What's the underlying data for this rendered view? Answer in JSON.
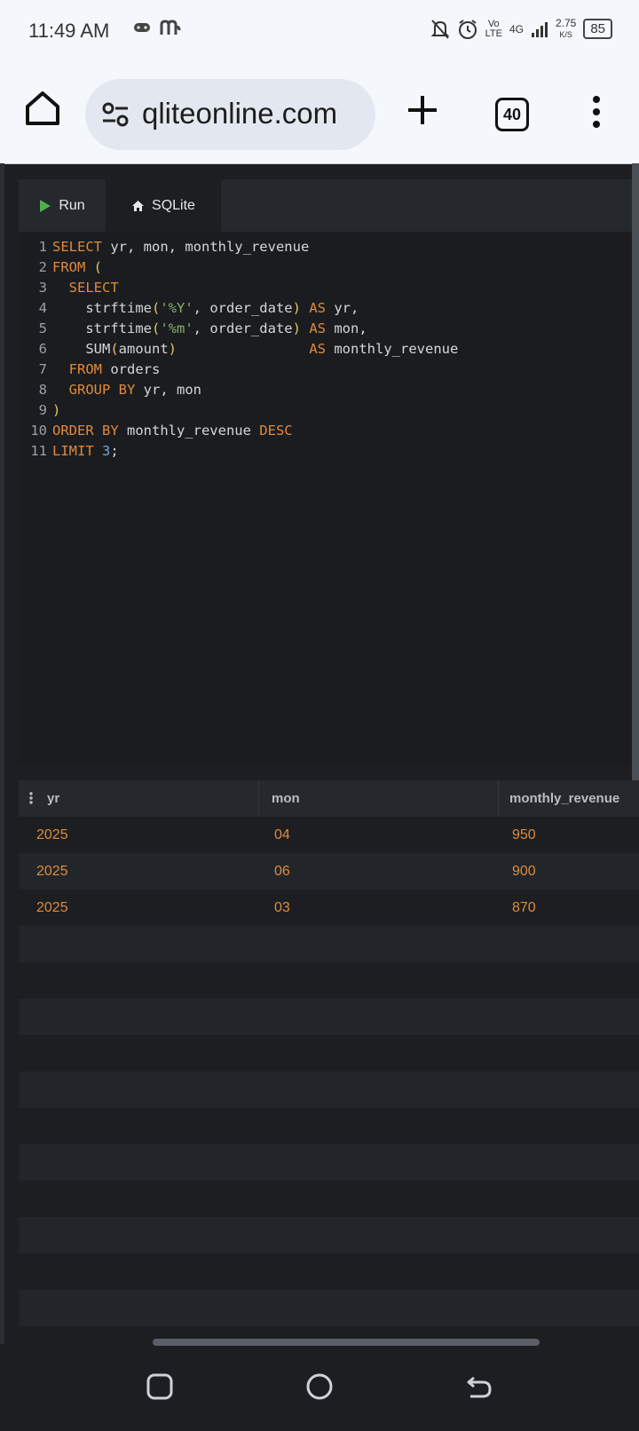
{
  "status_bar": {
    "time": "11:49 AM",
    "network": "4G",
    "speed": "2.75",
    "speed_unit": "K/S",
    "volte": "Vo",
    "volte_sub": "LTE",
    "battery": "85"
  },
  "browser": {
    "url": "qliteonline.com",
    "tab_count": "40"
  },
  "toolbar": {
    "run_label": "Run",
    "db_label": "SQLite"
  },
  "editor": {
    "lines": [
      "SELECT yr, mon, monthly_revenue",
      "FROM (",
      "  SELECT",
      "    strftime('%Y', order_date) AS yr,",
      "    strftime('%m', order_date) AS mon,",
      "    SUM(amount)                AS monthly_revenue",
      "  FROM orders",
      "  GROUP BY yr, mon",
      ")",
      "ORDER BY monthly_revenue DESC",
      "LIMIT 3;"
    ],
    "line_numbers": [
      "1",
      "2",
      "3",
      "4",
      "5",
      "6",
      "7",
      "8",
      "9",
      "10",
      "11"
    ]
  },
  "results": {
    "columns": [
      "yr",
      "mon",
      "monthly_revenue"
    ],
    "rows": [
      [
        "2025",
        "04",
        "950"
      ],
      [
        "2025",
        "06",
        "900"
      ],
      [
        "2025",
        "03",
        "870"
      ]
    ]
  },
  "colors": {
    "keyword": "#e08a3a",
    "string": "#8aab6c",
    "number": "#6fa8dc",
    "paren": "#e3c35d",
    "run_green": "#4caf50"
  }
}
